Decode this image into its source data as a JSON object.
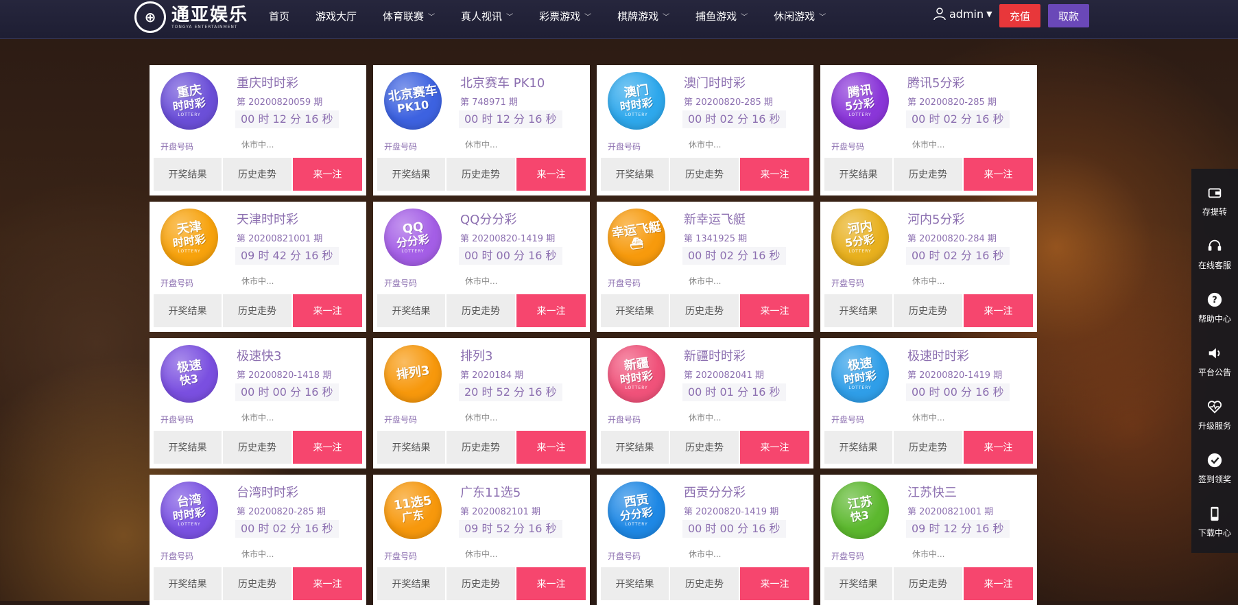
{
  "header": {
    "logo_cn": "通亚娱乐",
    "logo_en": "TONGYA ENTERTAINMENT",
    "nav": [
      {
        "label": "首页",
        "dropdown": false
      },
      {
        "label": "游戏大厅",
        "dropdown": false
      },
      {
        "label": "体育联赛",
        "dropdown": true
      },
      {
        "label": "真人视讯",
        "dropdown": true
      },
      {
        "label": "彩票游戏",
        "dropdown": true
      },
      {
        "label": "棋牌游戏",
        "dropdown": true
      },
      {
        "label": "捕鱼游戏",
        "dropdown": true
      },
      {
        "label": "休闲游戏",
        "dropdown": true
      }
    ],
    "username": "admin",
    "recharge_label": "充值",
    "withdraw_label": "取款"
  },
  "colors": {
    "accent_pink": "#f6466e",
    "recharge_red": "#e8373a",
    "withdraw_purple": "#6a48b8",
    "text_purple": "#8c6fb0"
  },
  "card_labels": {
    "draw_label": "开盘号码",
    "draw_status": "休市中...",
    "results": "开奖结果",
    "history": "历史走势",
    "bet": "来一注"
  },
  "games": [
    {
      "name": "重庆时时彩",
      "issue": "第 20200820059 期",
      "timer": "00 时 12 分 16 秒",
      "badge": [
        "重庆",
        "时时彩",
        "LOTTERY"
      ],
      "color": "#6b4fd8"
    },
    {
      "name": "北京赛车 PK10",
      "issue": "第 748971 期",
      "timer": "00 时 12 分 16 秒",
      "badge": [
        "北京赛车",
        "PK10",
        ""
      ],
      "color": "#3d62e0"
    },
    {
      "name": "澳门时时彩",
      "issue": "第 20200820-285 期",
      "timer": "00 时 02 分 16 秒",
      "badge": [
        "澳门",
        "时时彩",
        "LOTTERY"
      ],
      "color": "#2ea8ec"
    },
    {
      "name": "腾讯5分彩",
      "issue": "第 20200820-285 期",
      "timer": "00 时 02 分 16 秒",
      "badge": [
        "腾讯",
        "5分彩",
        "LOTTERY"
      ],
      "color": "#8a36d8"
    },
    {
      "name": "天津时时彩",
      "issue": "第 20200821001 期",
      "timer": "09 时 42 分 16 秒",
      "badge": [
        "天津",
        "时时彩",
        "LOTTERY"
      ],
      "color": "#f7a20c"
    },
    {
      "name": "QQ分分彩",
      "issue": "第 20200820-1419 期",
      "timer": "00 时 00 分 16 秒",
      "badge": [
        "QQ",
        "分分彩",
        "LOTTERY"
      ],
      "color": "#a45ee6"
    },
    {
      "name": "新幸运飞艇",
      "issue": "第 1341925 期",
      "timer": "00 时 02 分 16 秒",
      "badge": [
        "幸运飞艇",
        "⛴",
        ""
      ],
      "color": "#f79a0c"
    },
    {
      "name": "河内5分彩",
      "issue": "第 20200820-284 期",
      "timer": "00 时 02 分 16 秒",
      "badge": [
        "河内",
        "5分彩",
        "LOTTERY"
      ],
      "color": "#e8b01e"
    },
    {
      "name": "极速快3",
      "issue": "第 20200820-1418 期",
      "timer": "00 时 00 分 16 秒",
      "badge": [
        "极速",
        "快3",
        ""
      ],
      "color": "#7a4fe0"
    },
    {
      "name": "排列3",
      "issue": "第 2020184 期",
      "timer": "20 时 52 分 16 秒",
      "badge": [
        "排列3",
        "",
        ""
      ],
      "color": "#f7980c"
    },
    {
      "name": "新疆时时彩",
      "issue": "第 2020082041 期",
      "timer": "00 时 01 分 16 秒",
      "badge": [
        "新疆",
        "时时彩",
        "LOTTERY"
      ],
      "color": "#f0527a"
    },
    {
      "name": "极速时时彩",
      "issue": "第 20200820-1419 期",
      "timer": "00 时 00 分 16 秒",
      "badge": [
        "极速",
        "时时彩",
        "LOTTERY"
      ],
      "color": "#2f9ee8"
    },
    {
      "name": "台湾时时彩",
      "issue": "第 20200820-285 期",
      "timer": "00 时 02 分 16 秒",
      "badge": [
        "台湾",
        "时时彩",
        "LOTTERY"
      ],
      "color": "#7a52e2"
    },
    {
      "name": "广东11选5",
      "issue": "第 2020082101 期",
      "timer": "09 时 52 分 16 秒",
      "badge": [
        "11选5",
        "广东",
        ""
      ],
      "color": "#f7980c"
    },
    {
      "name": "西贡分分彩",
      "issue": "第 20200820-1419 期",
      "timer": "00 时 00 分 16 秒",
      "badge": [
        "西贡",
        "分分彩",
        "LOTTERY"
      ],
      "color": "#1e88e5"
    },
    {
      "name": "江苏快三",
      "issue": "第 20200821001 期",
      "timer": "09 时 12 分 16 秒",
      "badge": [
        "江苏",
        "快3",
        ""
      ],
      "color": "#5cb82e"
    }
  ],
  "sidebar": [
    {
      "label": "存提转",
      "icon": "wallet-icon"
    },
    {
      "label": "在线客服",
      "icon": "headset-icon"
    },
    {
      "label": "帮助中心",
      "icon": "help-icon"
    },
    {
      "label": "平台公告",
      "icon": "speaker-icon"
    },
    {
      "label": "升级服务",
      "icon": "heartbeat-icon"
    },
    {
      "label": "签到领奖",
      "icon": "check-icon"
    },
    {
      "label": "下载中心",
      "icon": "phone-icon"
    }
  ]
}
